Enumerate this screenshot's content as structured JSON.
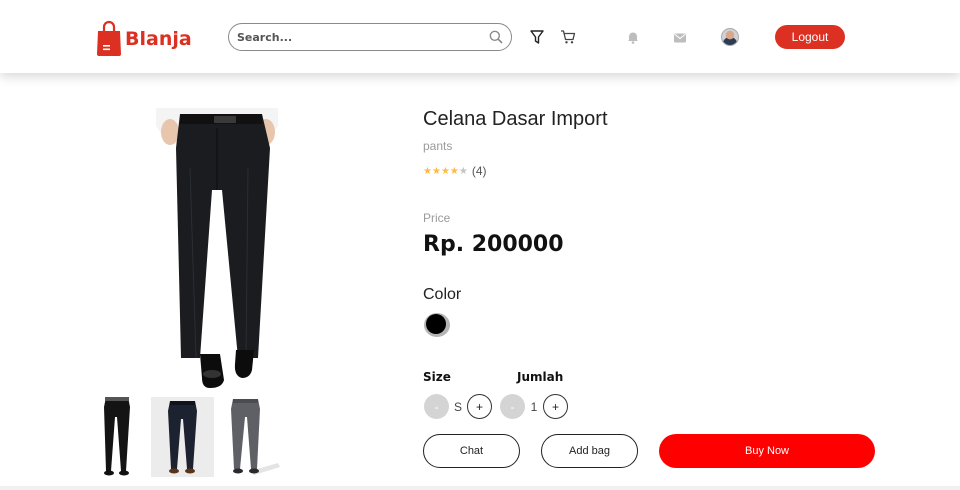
{
  "navbar": {
    "brand": "Blanja",
    "search_placeholder": "Search...",
    "logout_label": "Logout",
    "accent_color": "#DB3022",
    "icons": [
      "shopping-bag-icon",
      "search-icon",
      "filter-icon",
      "cart-icon",
      "bell-icon",
      "mail-icon"
    ]
  },
  "product": {
    "title": "Celana Dasar Import",
    "category": "pants",
    "rating": 4,
    "rating_max": 5,
    "rating_count": "(4)",
    "price_label": "Price",
    "price": "Rp. 200000",
    "color_label": "Color",
    "colors": [
      "#000000"
    ],
    "size_label": "Size",
    "size_value": "S",
    "quantity_label": "Jumlah",
    "quantity_value": "1",
    "minus_label": "-",
    "plus_label": "+"
  },
  "actions": {
    "chat_label": "Chat",
    "add_bag_label": "Add bag",
    "buy_now_label": "Buy Now",
    "buy_color": "#ff0000"
  }
}
